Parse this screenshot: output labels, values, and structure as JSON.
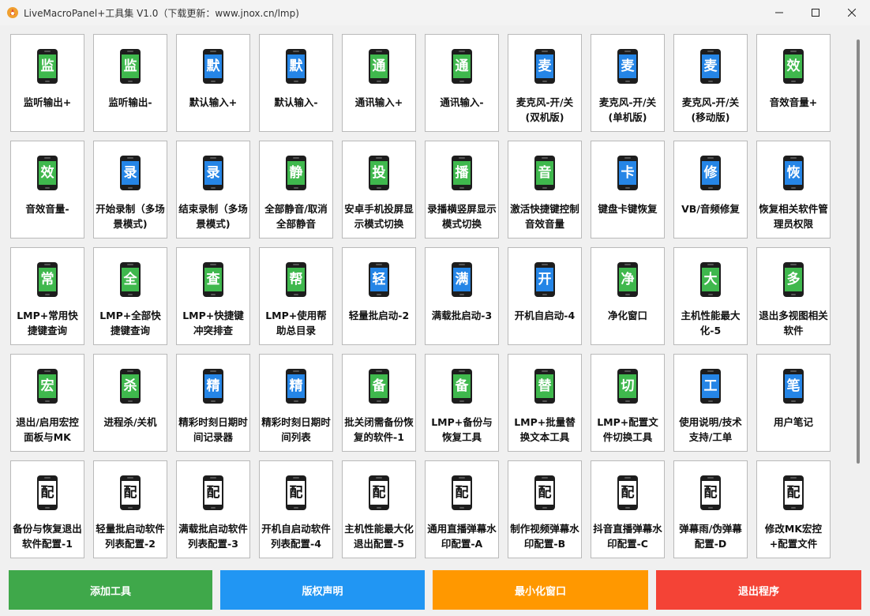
{
  "window": {
    "title": "LiveMacroPanel+工具集  V1.0（下载更新：www.jnox.cn/lmp)",
    "app_icon": "app-logo-icon",
    "controls": [
      "minimize-icon",
      "maximize-icon",
      "close-icon"
    ]
  },
  "colors": {
    "green": "#3fb84d",
    "blue": "#2585e6",
    "add": "#3fa84a",
    "copyright": "#2196f3",
    "minimize": "#ff9800",
    "exit": "#f44336"
  },
  "tools": [
    {
      "glyph": "监",
      "color": "green",
      "label": "监听输出+"
    },
    {
      "glyph": "监",
      "color": "green",
      "label": "监听输出-"
    },
    {
      "glyph": "默",
      "color": "blue",
      "label": "默认输入+"
    },
    {
      "glyph": "默",
      "color": "blue",
      "label": "默认输入-"
    },
    {
      "glyph": "通",
      "color": "green",
      "label": "通讯输入+"
    },
    {
      "glyph": "通",
      "color": "green",
      "label": "通讯输入-"
    },
    {
      "glyph": "麦",
      "color": "blue",
      "label": "麦克风-开/关(双机版)"
    },
    {
      "glyph": "麦",
      "color": "blue",
      "label": "麦克风-开/关(单机版)"
    },
    {
      "glyph": "麦",
      "color": "blue",
      "label": "麦克风-开/关(移动版)"
    },
    {
      "glyph": "效",
      "color": "green",
      "label": "音效音量+"
    },
    {
      "glyph": "效",
      "color": "green",
      "label": "音效音量-"
    },
    {
      "glyph": "录",
      "color": "blue",
      "label": "开始录制（多场景模式)"
    },
    {
      "glyph": "录",
      "color": "blue",
      "label": "结束录制（多场景模式)"
    },
    {
      "glyph": "静",
      "color": "green",
      "label": "全部静音/取消全部静音"
    },
    {
      "glyph": "投",
      "color": "green",
      "label": "安卓手机投屏显示模式切换"
    },
    {
      "glyph": "播",
      "color": "green",
      "label": "录播横竖屏显示模式切换"
    },
    {
      "glyph": "音",
      "color": "green",
      "label": "激活快捷键控制音效音量"
    },
    {
      "glyph": "卡",
      "color": "blue",
      "label": "键盘卡键恢复"
    },
    {
      "glyph": "修",
      "color": "blue",
      "label": "VB/音频修复"
    },
    {
      "glyph": "恢",
      "color": "blue",
      "label": "恢复相关软件管理员权限"
    },
    {
      "glyph": "常",
      "color": "green",
      "label": "LMP+常用快捷键查询"
    },
    {
      "glyph": "全",
      "color": "green",
      "label": "LMP+全部快捷键查询"
    },
    {
      "glyph": "查",
      "color": "green",
      "label": "LMP+快捷键冲突排查"
    },
    {
      "glyph": "帮",
      "color": "green",
      "label": "LMP+使用帮助总目录"
    },
    {
      "glyph": "轻",
      "color": "blue",
      "label": "轻量批启动-2"
    },
    {
      "glyph": "满",
      "color": "blue",
      "label": "满载批启动-3"
    },
    {
      "glyph": "开",
      "color": "blue",
      "label": "开机自启动-4"
    },
    {
      "glyph": "净",
      "color": "green",
      "label": "净化窗口"
    },
    {
      "glyph": "大",
      "color": "green",
      "label": "主机性能最大化-5"
    },
    {
      "glyph": "多",
      "color": "green",
      "label": "退出多视图相关软件"
    },
    {
      "glyph": "宏",
      "color": "green",
      "label": "退出/启用宏控面板与MK"
    },
    {
      "glyph": "杀",
      "color": "green",
      "label": "进程杀/关机"
    },
    {
      "glyph": "精",
      "color": "blue",
      "label": "精彩时刻日期时间记录器"
    },
    {
      "glyph": "精",
      "color": "blue",
      "label": "精彩时刻日期时间列表"
    },
    {
      "glyph": "备",
      "color": "green",
      "label": "批关闭需备份恢复的软件-1"
    },
    {
      "glyph": "备",
      "color": "green",
      "label": "LMP+备份与恢复工具"
    },
    {
      "glyph": "替",
      "color": "green",
      "label": "LMP+批量替换文本工具"
    },
    {
      "glyph": "切",
      "color": "green",
      "label": "LMP+配置文件切换工具"
    },
    {
      "glyph": "工",
      "color": "blue",
      "label": "使用说明/技术支持/工单"
    },
    {
      "glyph": "笔",
      "color": "blue",
      "label": "用户笔记"
    },
    {
      "glyph": "配",
      "color": "white",
      "label": "备份与恢复退出软件配置-1"
    },
    {
      "glyph": "配",
      "color": "white",
      "label": "轻量批启动软件列表配置-2"
    },
    {
      "glyph": "配",
      "color": "white",
      "label": "满载批启动软件列表配置-3"
    },
    {
      "glyph": "配",
      "color": "white",
      "label": "开机自启动软件列表配置-4"
    },
    {
      "glyph": "配",
      "color": "white",
      "label": "主机性能最大化退出配置-5"
    },
    {
      "glyph": "配",
      "color": "white",
      "label": "通用直播弹幕水印配置-A"
    },
    {
      "glyph": "配",
      "color": "white",
      "label": "制作视频弹幕水印配置-B"
    },
    {
      "glyph": "配",
      "color": "white",
      "label": "抖音直播弹幕水印配置-C"
    },
    {
      "glyph": "配",
      "color": "white",
      "label": "弹幕雨/伪弹幕配置-D"
    },
    {
      "glyph": "配",
      "color": "white",
      "label": "修改MK宏控+配置文件"
    }
  ],
  "bottom_buttons": [
    {
      "id": "add-tool",
      "label": "添加工具",
      "color": "add"
    },
    {
      "id": "copyright",
      "label": "版权声明",
      "color": "copyright"
    },
    {
      "id": "minimize-window",
      "label": "最小化窗口",
      "color": "minimize"
    },
    {
      "id": "exit-program",
      "label": "退出程序",
      "color": "exit"
    }
  ]
}
